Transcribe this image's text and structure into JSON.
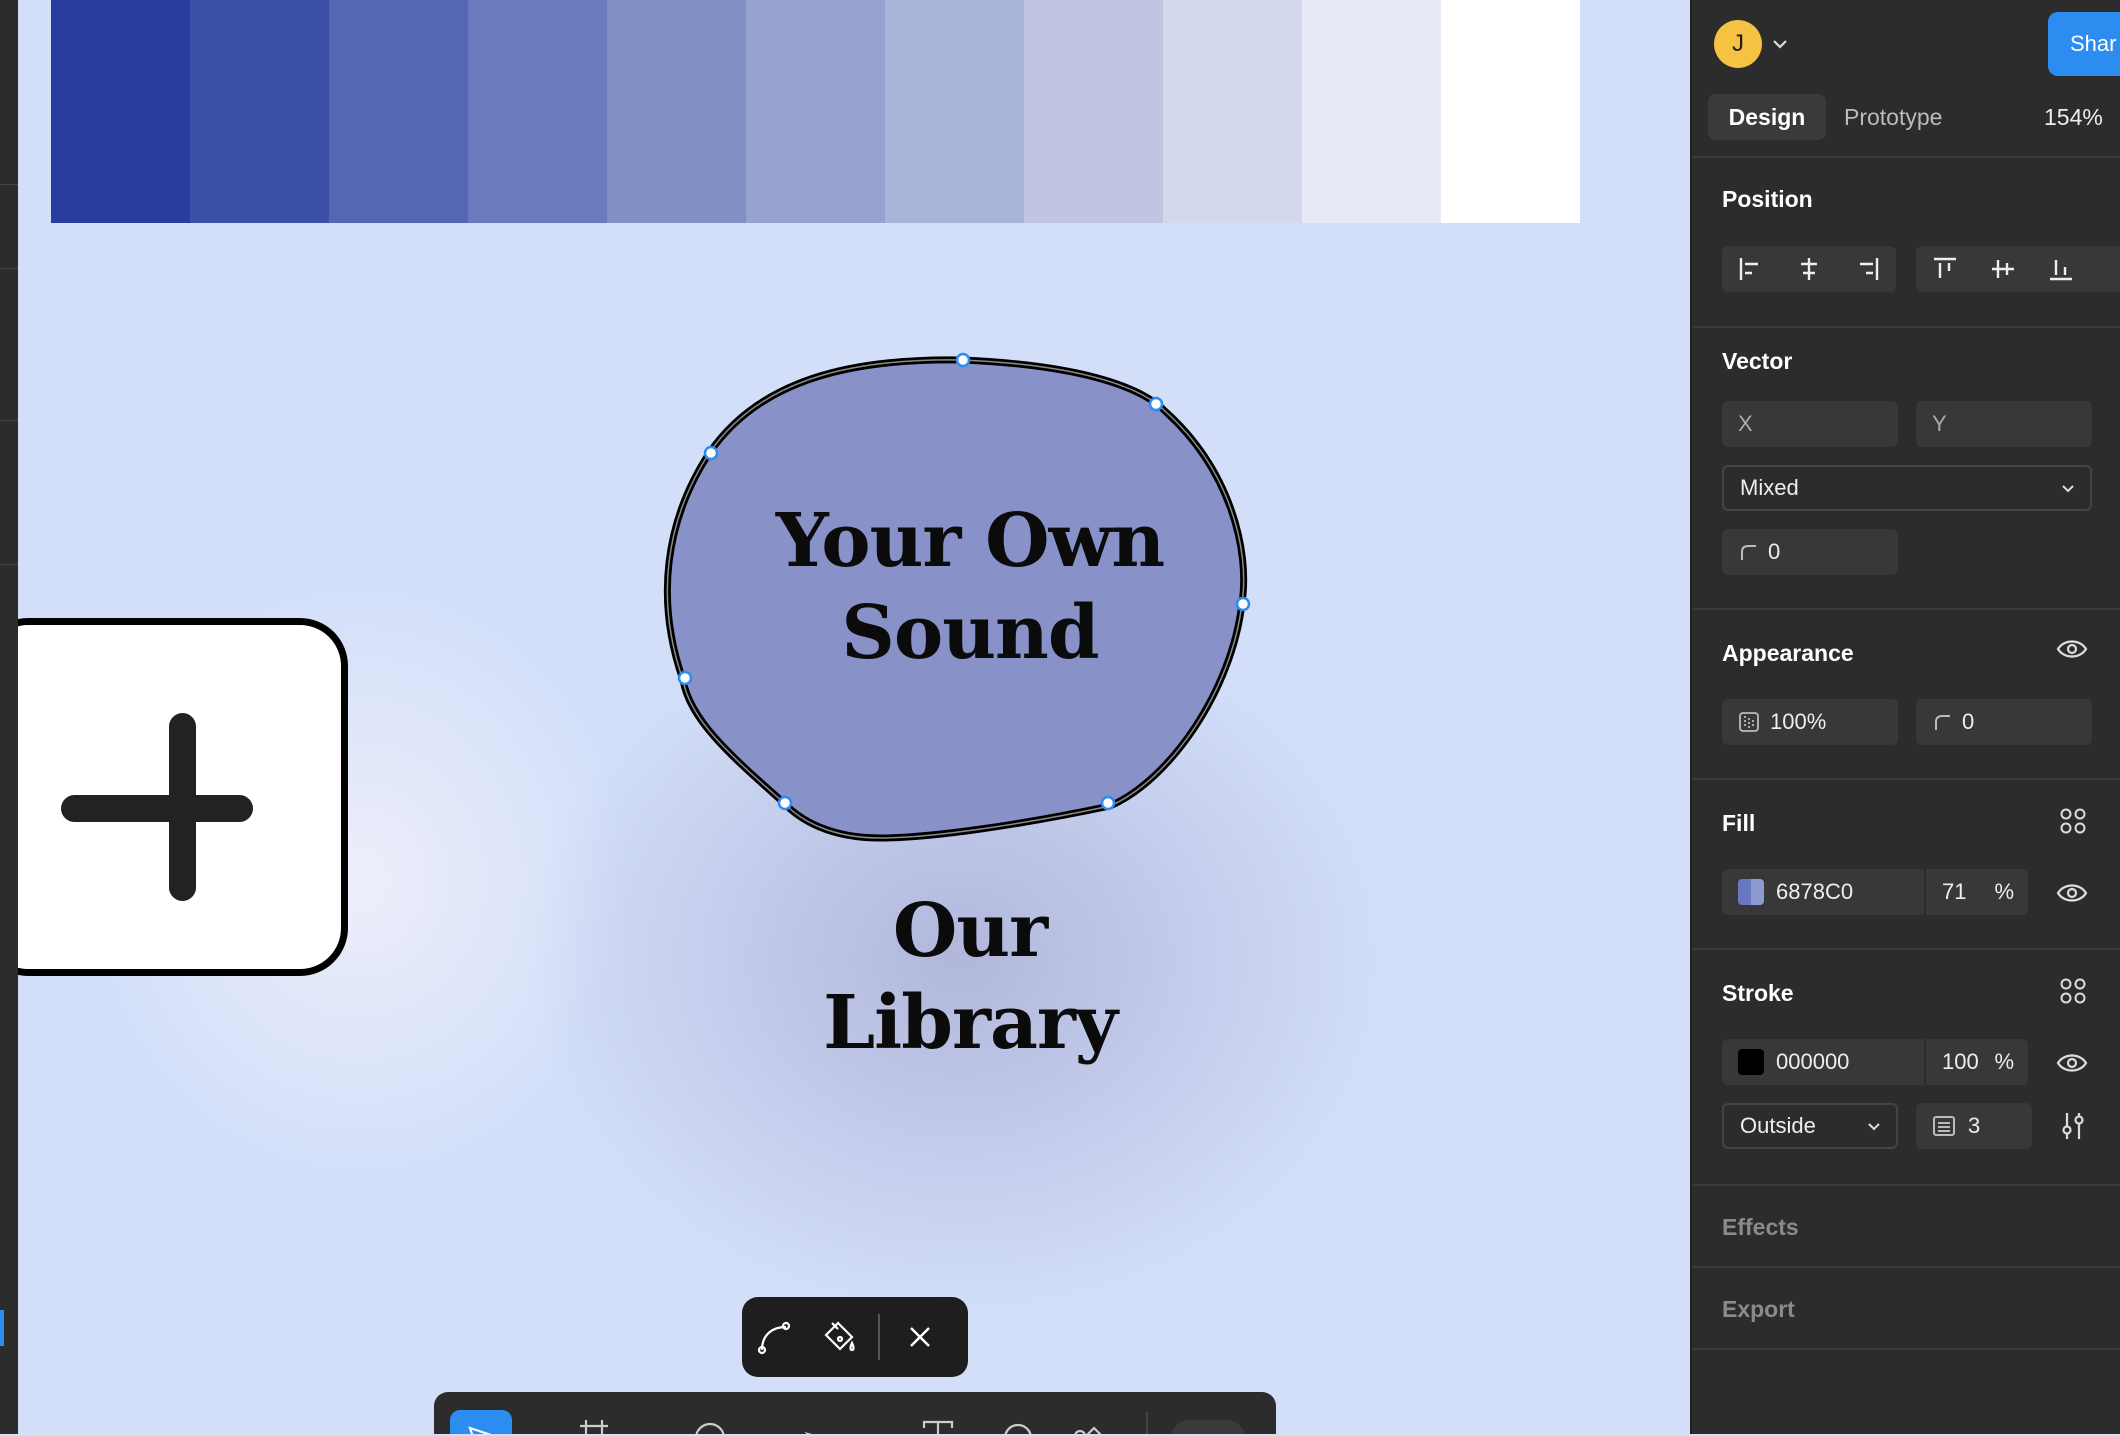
{
  "canvas": {
    "palette": [
      "#2a3d9e",
      "#3d50a8",
      "#5566b2",
      "#6b7abc",
      "#8190c4",
      "#96a3cf",
      "#aab4d9",
      "#c0c5e2",
      "#d4d8ec",
      "#e7eaf6",
      "#ffffff"
    ],
    "blob_title": [
      "Your Own",
      "Sound"
    ],
    "library_title": [
      "Our",
      "Library"
    ],
    "blob_fill": "#8891c8"
  },
  "header": {
    "avatar_initial": "J",
    "share_label": "Shar",
    "tabs": {
      "design": "Design",
      "prototype": "Prototype"
    },
    "zoom": "154%"
  },
  "position": {
    "title": "Position"
  },
  "vector": {
    "title": "Vector",
    "x_placeholder": "X",
    "y_placeholder": "Y",
    "mode": "Mixed",
    "corner_radius": "0"
  },
  "appearance": {
    "title": "Appearance",
    "opacity": "100%",
    "corner_radius": "0"
  },
  "fill": {
    "title": "Fill",
    "hex": "6878C0",
    "opacity": "71",
    "percent": "%",
    "swatch_color": "#6878c0"
  },
  "stroke": {
    "title": "Stroke",
    "hex": "000000",
    "opacity": "100",
    "percent": "%",
    "position": "Outside",
    "weight": "3",
    "swatch_color": "#000000"
  },
  "effects": {
    "title": "Effects"
  },
  "export": {
    "title": "Export"
  }
}
